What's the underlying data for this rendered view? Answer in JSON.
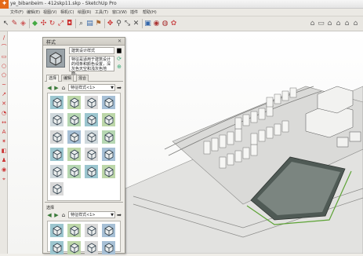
{
  "window": {
    "title": "ye_bibanbeim - 412skp11.skp - SketchUp Pro"
  },
  "menu": [
    "文件(F)",
    "编辑(E)",
    "视图(V)",
    "相机(C)",
    "绘图(R)",
    "工具(T)",
    "窗口(W)",
    "插件",
    "帮助(H)"
  ],
  "toolbar": {
    "left_icons": [
      "select-icon",
      "pencil-icon",
      "eraser-icon",
      "push-pull-icon",
      "move-icon",
      "rotate-icon",
      "scale-icon",
      "offset-icon",
      "tape-icon",
      "paint-icon",
      "orbit-icon",
      "pan-icon",
      "zoom-icon",
      "zoom-extents-icon",
      "components-icon",
      "materials-icon",
      "styles-icon"
    ],
    "right_icons": [
      "iso-view-icon",
      "top-view-icon",
      "front-view-icon",
      "right-view-icon",
      "back-view-icon",
      "left-view-icon"
    ]
  },
  "styles_panel": {
    "title": "样式",
    "style_name": "建筑设计样式",
    "style_description": "特征是适用于建筑设计的线条和颜色设置，深灰色天空和浅灰色地面。",
    "description_lines": [
      "特征是适用于建筑设计的线条和颜色设置，深灰色天空和浅灰色地面。"
    ],
    "tabs": [
      "选择",
      "编辑",
      "混合"
    ],
    "active_tab": "选择",
    "collection_select": "特征样式<1>",
    "lower_title": "选择",
    "lower_collection_select": "特征样式<1>"
  },
  "colors": {
    "viewport_bg": "#ffffff",
    "ground_gray": "#d8d8d6",
    "panel_bg": "#eeece7",
    "accent_orange": "#e46a1a"
  }
}
